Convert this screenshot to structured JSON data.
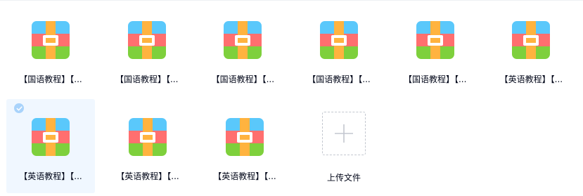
{
  "files": [
    {
      "name": "【国语教程】【...",
      "selected": false
    },
    {
      "name": "【国语教程】【...",
      "selected": false
    },
    {
      "name": "【国语教程】【...",
      "selected": false
    },
    {
      "name": "【国语教程】【...",
      "selected": false
    },
    {
      "name": "【国语教程】【...",
      "selected": false
    },
    {
      "name": "【英语教程】【...",
      "selected": false
    },
    {
      "name": "【英语教程】【...",
      "selected": true
    },
    {
      "name": "【英语教程】【...",
      "selected": false
    },
    {
      "name": "【英语教程】【...",
      "selected": false
    }
  ],
  "upload": {
    "label": "上传文件",
    "icon": "plus-icon"
  },
  "icons": {
    "file": "archive-icon",
    "check": "check-icon"
  },
  "colors": {
    "archive_top": "#5ac8fb",
    "archive_middle": "#ff6f6f",
    "archive_bottom": "#7ed03c",
    "archive_strap": "#ffb33f",
    "selected_bg": "#f0f7ff",
    "check_bg": "#a9d3fb",
    "text": "#03081a"
  }
}
